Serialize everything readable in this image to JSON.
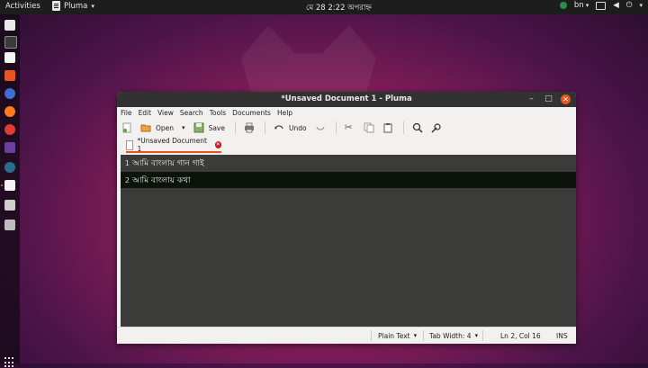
{
  "topbar": {
    "activities": "Activities",
    "app_name": "Pluma",
    "clock": "মে 28  2:22 অপরাহ্ন",
    "lang": "bn"
  },
  "window": {
    "title": "*Unsaved Document 1 - Pluma",
    "menu": [
      "File",
      "Edit",
      "View",
      "Search",
      "Tools",
      "Documents",
      "Help"
    ],
    "toolbar": {
      "open": "Open",
      "save": "Save",
      "undo": "Undo"
    },
    "tab": {
      "label": "*Unsaved Document 1"
    },
    "lines": [
      {
        "num": "1",
        "text": "আমি বাংলায় গান গাই"
      },
      {
        "num": "2",
        "text": "আমি বাংলায় কথা"
      }
    ],
    "status": {
      "syntax": "Plain Text",
      "tab_width": "Tab Width:  4",
      "position": "Ln 2, Col 16",
      "mode": "INS"
    }
  },
  "colors": {
    "accent": "#e95420",
    "titlebar": "#333232",
    "editor_bg": "#3b3b39"
  }
}
